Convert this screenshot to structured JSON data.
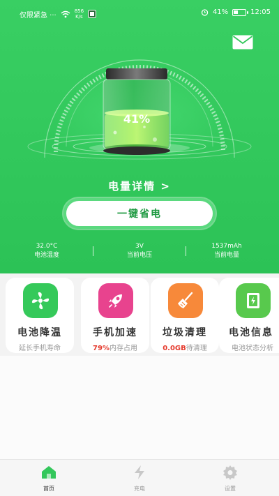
{
  "status_bar": {
    "carrier": "仅限紧急 ···",
    "net_speed_value": "856",
    "net_speed_unit": "K/s",
    "battery_percent": "41%",
    "time": "12:05"
  },
  "battery": {
    "level_text": "41%",
    "level": 0.41
  },
  "power_detail_label": "电量详情 >",
  "charge_button_label": "一键省电",
  "stats": [
    {
      "value": "32.0°C",
      "label": "电池温度"
    },
    {
      "value": "3V",
      "label": "当前电压"
    },
    {
      "value": "1537mAh",
      "label": "当前电量"
    }
  ],
  "features": [
    {
      "title": "电池降温",
      "sub_highlight": "",
      "sub": "延长手机寿命",
      "color": "#35c95a",
      "icon": "fan-icon"
    },
    {
      "title": "手机加速",
      "sub_highlight": "79%",
      "sub": "内存占用",
      "color": "#e8438e",
      "icon": "rocket-icon"
    },
    {
      "title": "垃圾清理",
      "sub_highlight": "0.0GB",
      "sub": "待清理",
      "color": "#f7893a",
      "icon": "broom-icon"
    },
    {
      "title": "电池信息",
      "sub_highlight": "",
      "sub": "电池状态分析",
      "color": "#58c94d",
      "icon": "battery-info-icon"
    }
  ],
  "tabs": [
    {
      "label": "首页",
      "icon": "home-icon",
      "active": true
    },
    {
      "label": "充电",
      "icon": "charge-icon",
      "active": false
    },
    {
      "label": "设置",
      "icon": "gear-icon",
      "active": false
    }
  ],
  "colors": {
    "primary_green": "#33c75b",
    "highlight_red": "#e53b2e"
  }
}
